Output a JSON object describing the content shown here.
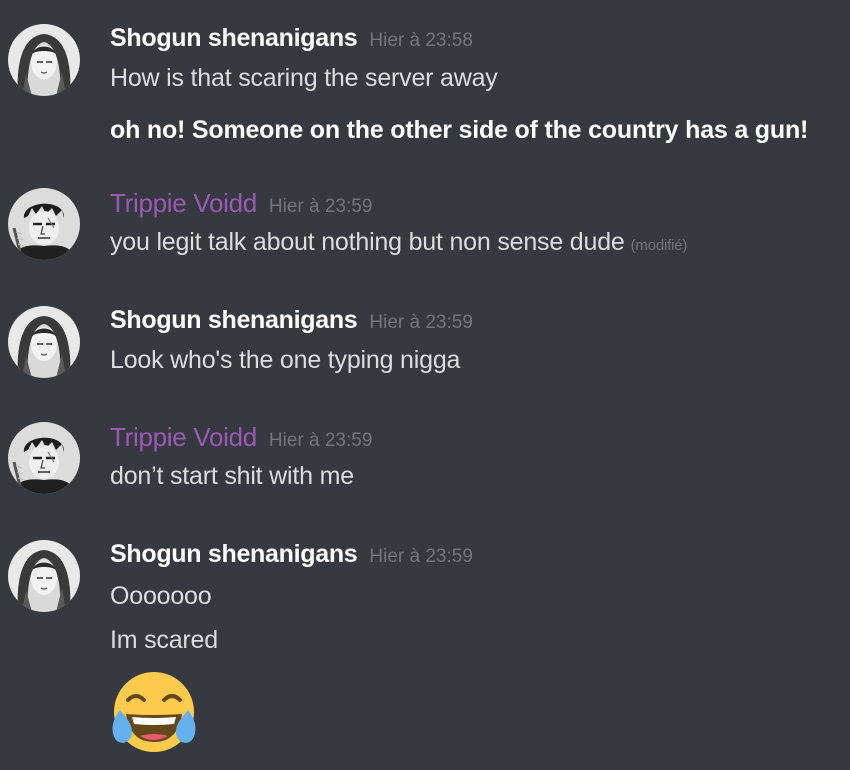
{
  "messages": [
    {
      "author": "Shogun shenanigans",
      "author_color": "#ffffff",
      "timestamp": "Hier à 23:58",
      "lines": [
        "How is that scaring the server away",
        "oh no! Someone on the other side of the country has a gun!"
      ]
    },
    {
      "author": "Trippie Voidd",
      "author_color": "#9b59b6",
      "timestamp": "Hier à 23:59",
      "lines": [
        "you legit talk about nothing but non sense dude"
      ],
      "edited_label": "(modifié)"
    },
    {
      "author": "Shogun shenanigans",
      "author_color": "#ffffff",
      "timestamp": "Hier à 23:59",
      "lines": [
        "Look who's the one typing nigga"
      ]
    },
    {
      "author": "Trippie Voidd",
      "author_color": "#9b59b6",
      "timestamp": "Hier à 23:59",
      "lines": [
        "don’t start shit with me"
      ]
    },
    {
      "author": "Shogun shenanigans",
      "author_color": "#ffffff",
      "timestamp": "Hier à 23:59",
      "lines": [
        "Ooooooo",
        "Im scared"
      ],
      "emoji": "face-with-tears-of-joy-emoji"
    }
  ],
  "colors": {
    "background": "#36393f",
    "text": "#dcddde",
    "timestamp": "#72767d",
    "purple_role": "#9b59b6"
  }
}
